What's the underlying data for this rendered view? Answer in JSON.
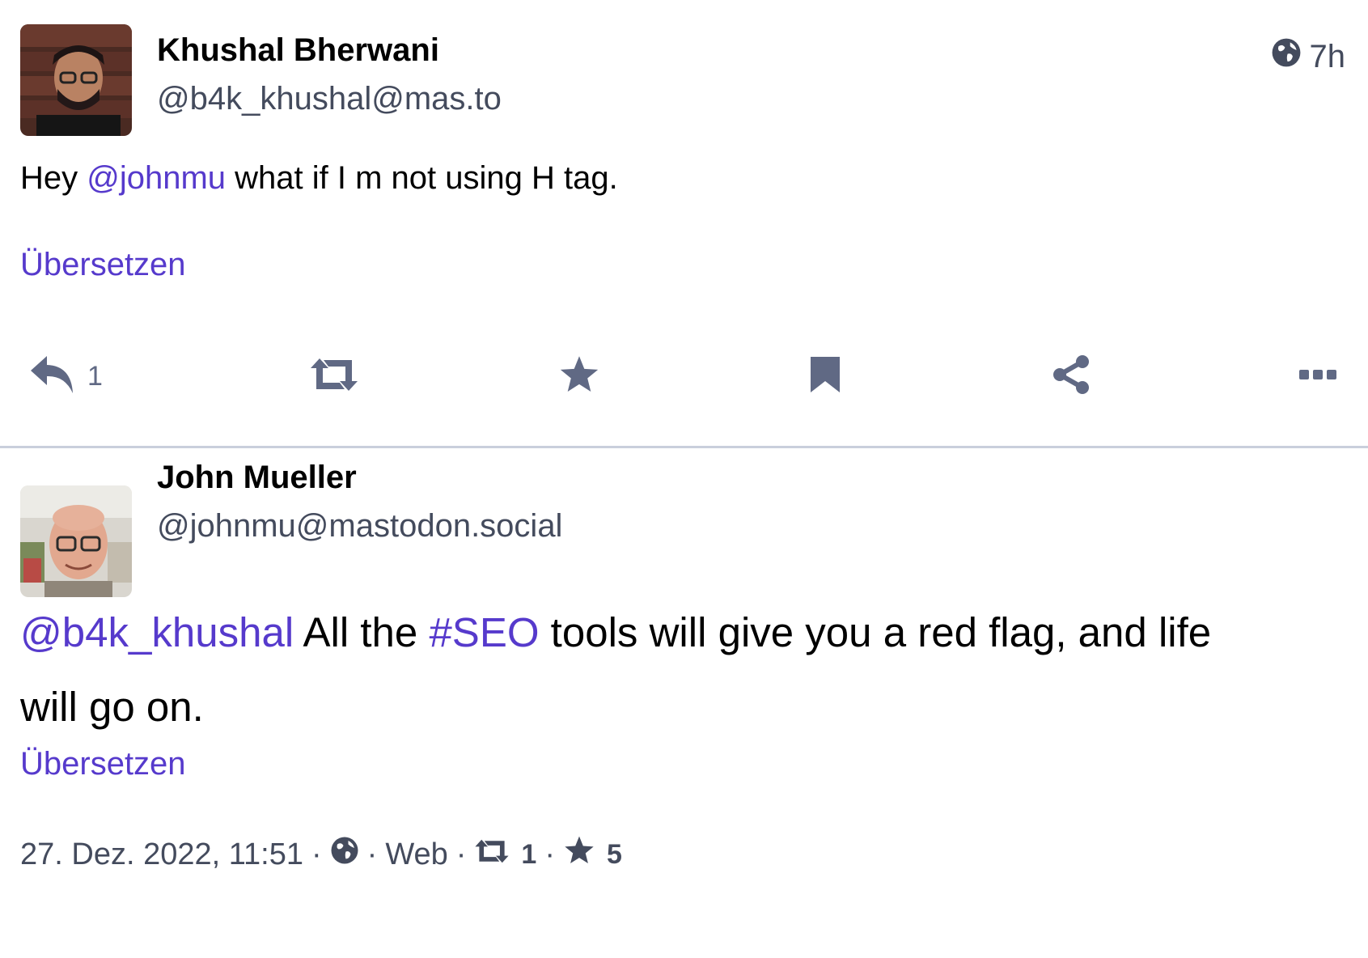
{
  "posts": [
    {
      "author": "Khushal Bherwani",
      "handle": "@b4k_khushal@mas.to",
      "time": "7h",
      "content": {
        "mention": "@johnmu",
        "before": "Hey ",
        "after": " what if I m not using H tag."
      },
      "translate": "Übersetzen",
      "actions": {
        "reply_count": "1"
      }
    },
    {
      "author": "John Mueller",
      "handle": "@johnmu@mastodon.social",
      "content": {
        "mention": "@b4k_khushal",
        "text1": " All the ",
        "hashtag": "#SEO",
        "text2": " tools will give you a red flag, and life",
        "line2": "will go on."
      },
      "translate": "Übersetzen",
      "meta": {
        "date": "27. Dez. 2022, 11:51",
        "sep": "·",
        "app": "Web",
        "boosts": "1",
        "favourites": "5"
      }
    }
  ],
  "colors": {
    "link": "#563acc",
    "icon": "#606984",
    "divider": "#c9cfdc"
  },
  "icons": [
    "globe-icon",
    "reply-icon",
    "boost-icon",
    "star-icon",
    "bookmark-icon",
    "share-icon",
    "more-icon"
  ]
}
